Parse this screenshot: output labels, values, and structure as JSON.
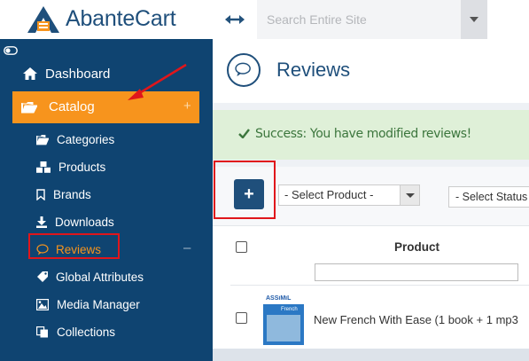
{
  "brand": {
    "name": "AbanteCart"
  },
  "search": {
    "placeholder": "Search Entire Site"
  },
  "sidebar": {
    "dashboard": {
      "label": "Dashboard"
    },
    "catalog": {
      "label": "Catalog",
      "expand": "+"
    },
    "items": [
      {
        "label": "Categories",
        "icon": "folder-open-icon"
      },
      {
        "label": "Products",
        "icon": "cubes-icon"
      },
      {
        "label": "Brands",
        "icon": "bookmark-icon"
      },
      {
        "label": "Downloads",
        "icon": "download-icon"
      },
      {
        "label": "Reviews",
        "icon": "comment-icon",
        "active": true,
        "collapse": "–"
      },
      {
        "label": "Global Attributes",
        "icon": "tags-icon"
      },
      {
        "label": "Media Manager",
        "icon": "image-icon"
      },
      {
        "label": "Collections",
        "icon": "copy-icon"
      }
    ]
  },
  "page": {
    "title": "Reviews",
    "alert": "Success: You have modified reviews!",
    "add_label": "+",
    "filters": {
      "product": "- Select Product -",
      "status": "- Select Status -"
    },
    "table": {
      "column_product": "Product",
      "rows": [
        {
          "product": "New French With Ease (1 book + 1 mp3",
          "thumb_brand": "ASSiMiL",
          "thumb_lang": "French"
        }
      ]
    }
  },
  "colors": {
    "sidebar": "#0f4471",
    "accent": "#f7941d",
    "primary": "#1f4f7b",
    "success_bg": "#dff0d8",
    "success_text": "#3c763d",
    "annotation": "#e0161b"
  }
}
